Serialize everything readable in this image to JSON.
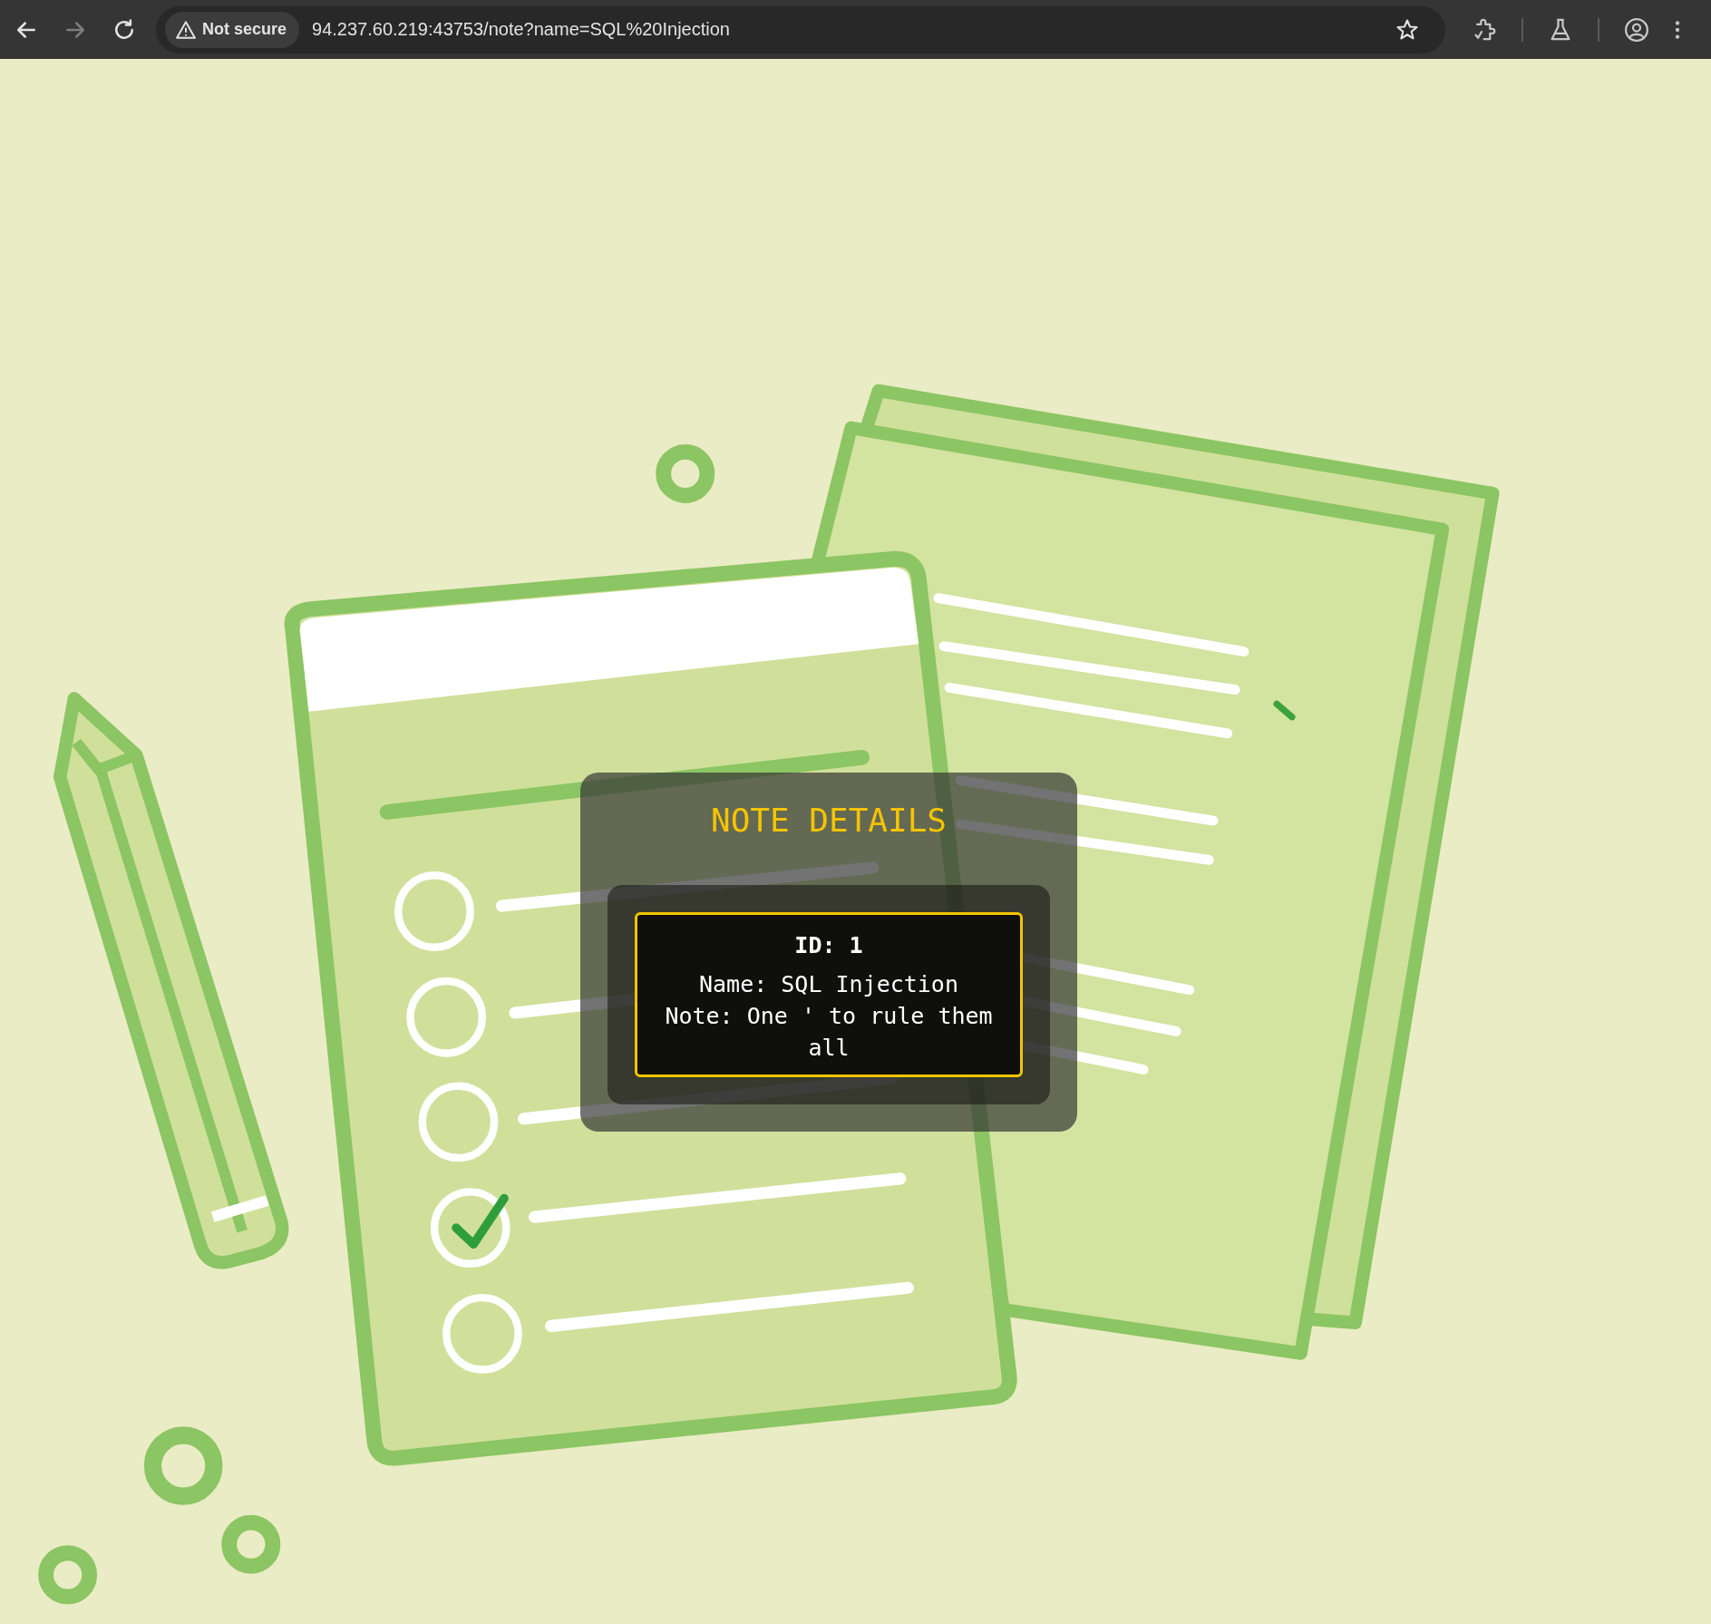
{
  "browser": {
    "nav_buttons": [
      {
        "kind": "back",
        "disabled": false
      },
      {
        "kind": "forward",
        "disabled": true
      },
      {
        "kind": "reload",
        "disabled": false
      }
    ],
    "security_label": "Not secure",
    "url": "94.237.60.219:43753/note?name=SQL%20Injection"
  },
  "note": {
    "title": "NOTE DETAILS",
    "lines": [
      {
        "kind": "id",
        "text": "ID: 1"
      },
      {
        "kind": "field",
        "text": "Name: SQL Injection"
      },
      {
        "kind": "field",
        "text": "Note: One ' to rule them all"
      }
    ]
  }
}
